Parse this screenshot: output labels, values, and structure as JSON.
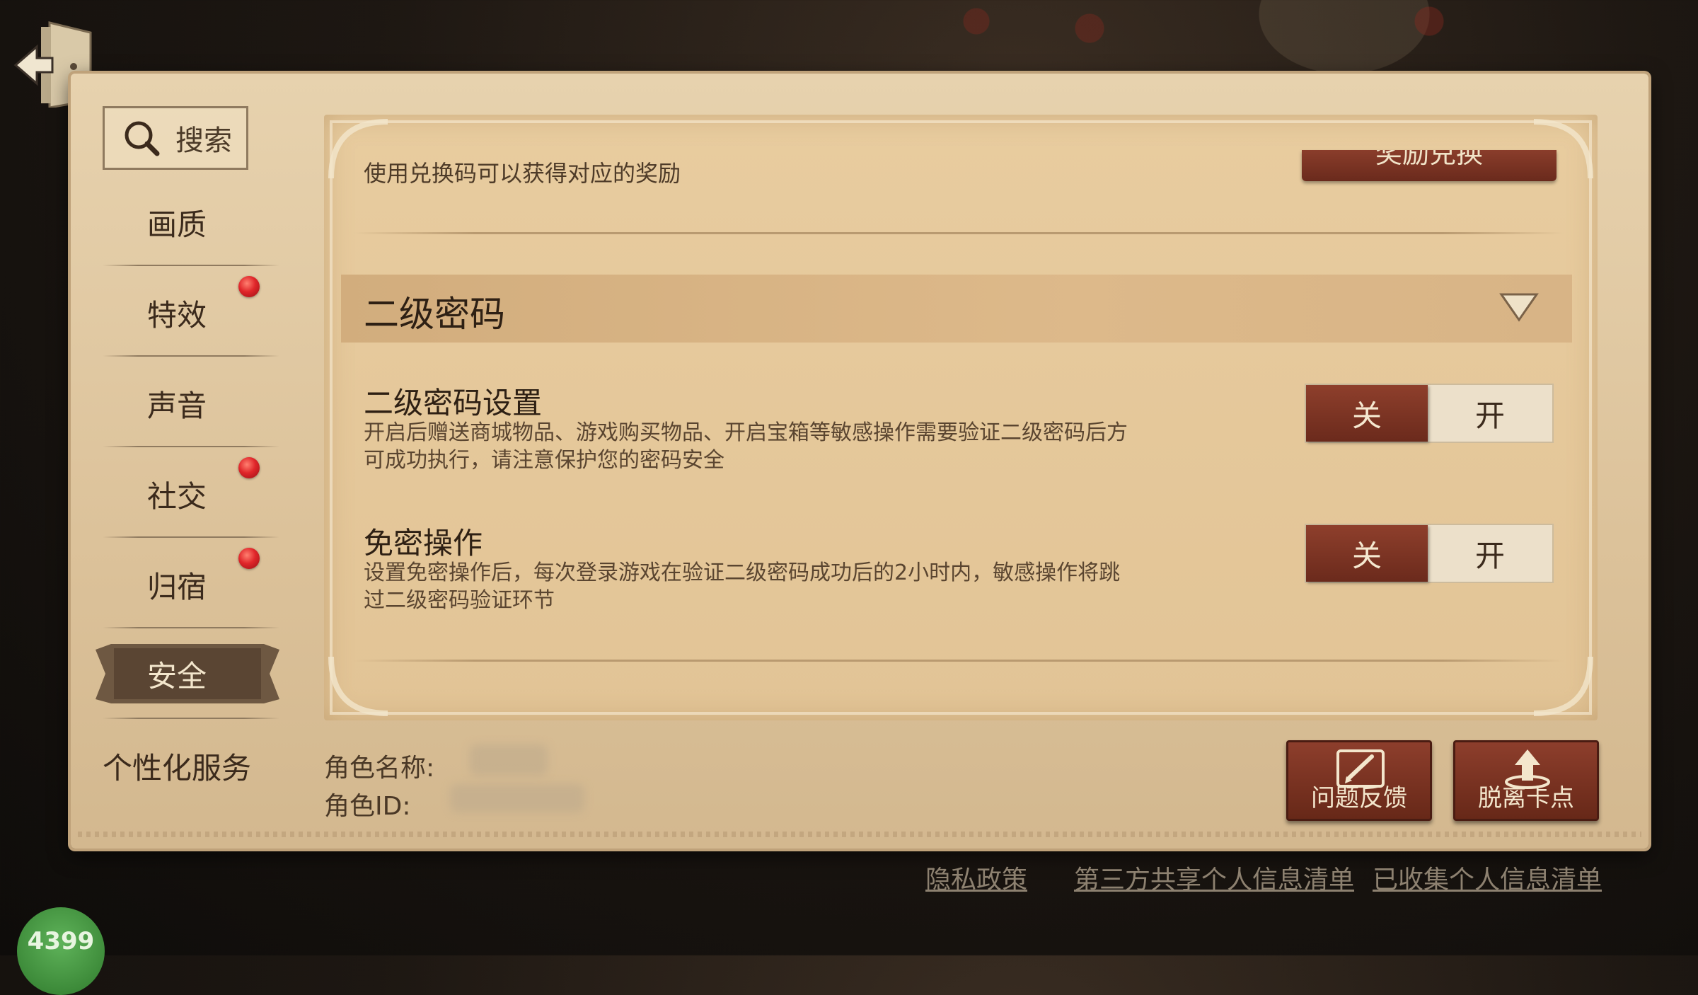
{
  "search": {
    "label": "搜索"
  },
  "sidebar": {
    "items": [
      {
        "label": "画质",
        "badge": false
      },
      {
        "label": "特效",
        "badge": true
      },
      {
        "label": "声音",
        "badge": false
      },
      {
        "label": "社交",
        "badge": true
      },
      {
        "label": "归宿",
        "badge": true
      },
      {
        "label": "安全",
        "badge": false,
        "active": true
      },
      {
        "label": "个性化服务",
        "badge": false
      }
    ]
  },
  "reward": {
    "description": "使用兑换码可以获得对应的奖励",
    "button_label": "奖励兑换"
  },
  "section": {
    "title": "二级密码"
  },
  "options": [
    {
      "title": "二级密码设置",
      "description": "开启后赠送商城物品、游戏购买物品、开启宝箱等敏感操作需要验证二级密码后方可成功执行，请注意保护您的密码安全",
      "off_label": "关",
      "on_label": "开",
      "state": "off"
    },
    {
      "title": "免密操作",
      "description": "设置免密操作后，每次登录游戏在验证二级密码成功后的2小时内，敏感操作将跳过二级密码验证环节",
      "off_label": "关",
      "on_label": "开",
      "state": "off"
    }
  ],
  "footer": {
    "role_name_label": "角色名称:",
    "role_id_label": "角色ID:",
    "feedback_label": "问题反馈",
    "unstuck_label": "脱离卡点",
    "links": [
      "隐私政策",
      "第三方共享个人信息清单",
      "已收集个人信息清单"
    ]
  },
  "badge_text": "4399",
  "colors": {
    "accent_red": "#6b2a1c",
    "parchment": "#e2c496",
    "notification_dot": "#e0262a"
  }
}
